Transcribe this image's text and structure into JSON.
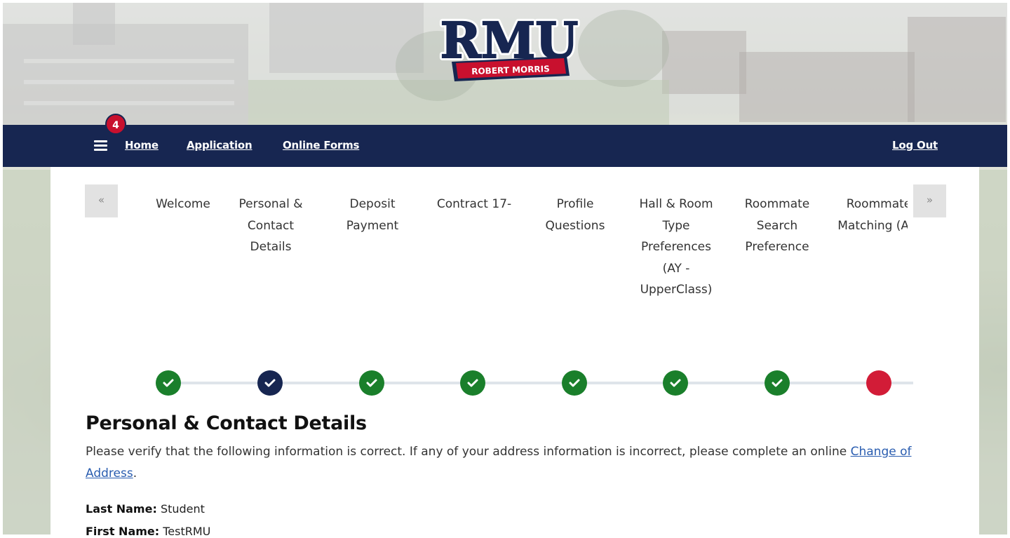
{
  "logo": {
    "main_text": "RMU",
    "ribbon_text": "ROBERT MORRIS",
    "colors": {
      "navy": "#172651",
      "red": "#c8102e",
      "white": "#ffffff"
    }
  },
  "nav": {
    "menu_icon": "hamburger-icon",
    "notification_count": "4",
    "links": {
      "home": "Home",
      "application": "Application",
      "online_forms": "Online Forms"
    },
    "logout": "Log Out",
    "background_color": "#172651"
  },
  "steps": {
    "prev_icon": "«",
    "next_icon": "»",
    "items": [
      {
        "label": "Welcome",
        "status": "complete"
      },
      {
        "label": "Personal & Contact Details",
        "status": "current"
      },
      {
        "label": "Deposit Payment",
        "status": "complete"
      },
      {
        "label": "Contract 17-",
        "status": "complete"
      },
      {
        "label": "Profile Questions",
        "status": "complete"
      },
      {
        "label": "Hall & Room Type Preferences (AY - UpperClass)",
        "status": "complete"
      },
      {
        "label": "Roommate Search Preference",
        "status": "complete"
      },
      {
        "label": "Roommate Matching (AY)",
        "status": "incomplete"
      }
    ],
    "status_colors": {
      "complete": "#1a7f2b",
      "current": "#172651",
      "incomplete": "#d21c37"
    }
  },
  "content": {
    "title": "Personal & Contact Details",
    "intro_text": "Please verify that the following information is correct. If any of your address information is incorrect, please complete an online ",
    "link_text": "Change of Address",
    "intro_suffix": ".",
    "fields": {
      "last_name_label": "Last Name:",
      "last_name_value": "Student",
      "first_name_label": "First Name:",
      "first_name_value": "TestRMU"
    }
  }
}
